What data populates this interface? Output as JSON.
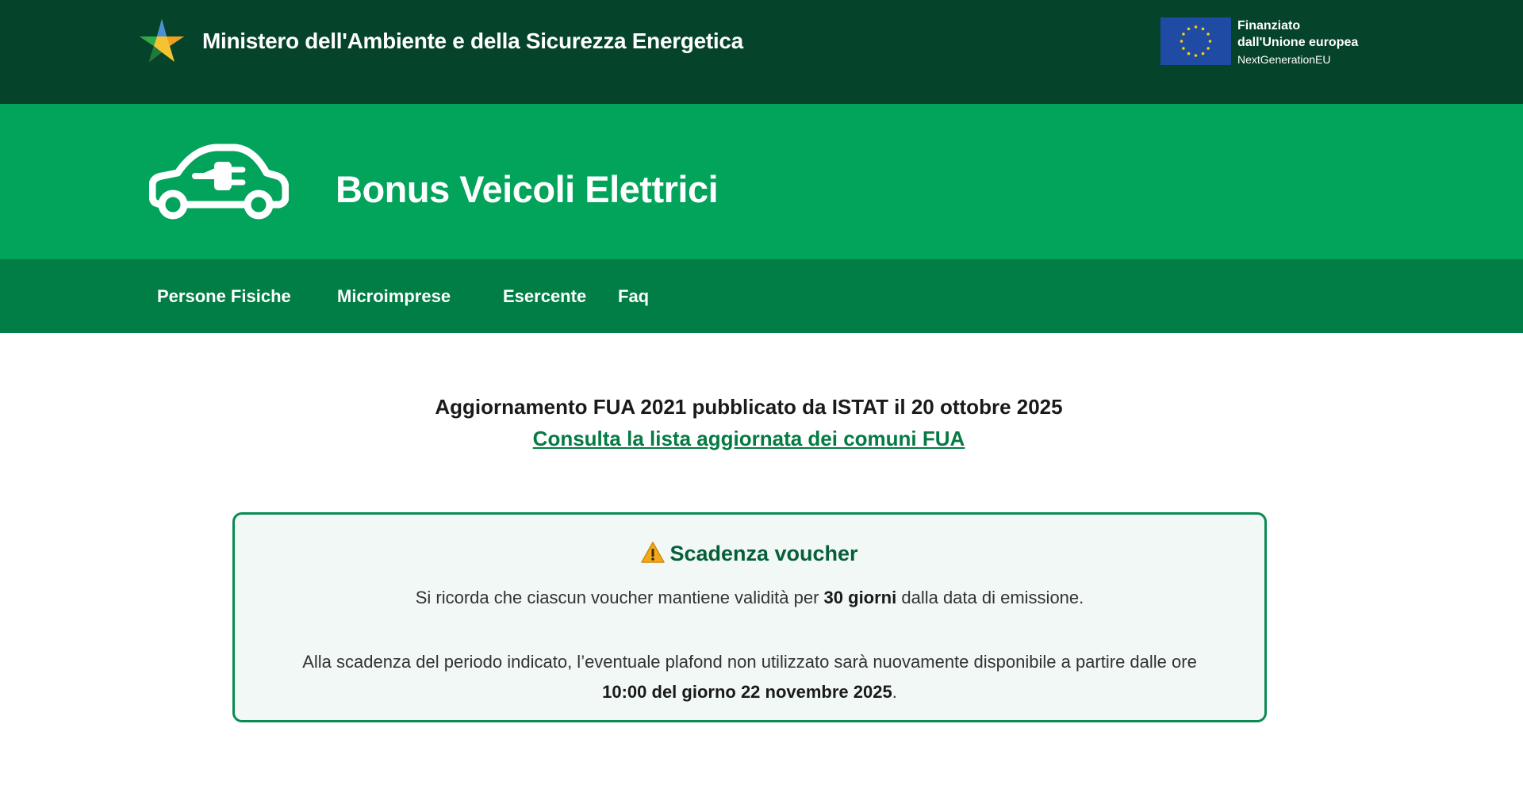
{
  "header": {
    "ministry_name": "Ministero dell'Ambiente e della Sicurezza Energetica",
    "eu_line1": "Finanziato",
    "eu_line2": "dall'Unione europea",
    "eu_line3": "NextGenerationEU"
  },
  "hero": {
    "title": "Bonus Veicoli Elettrici"
  },
  "nav": {
    "items": [
      {
        "label": "Persone Fisiche"
      },
      {
        "label": "Microimprese"
      },
      {
        "label": "Esercente"
      },
      {
        "label": "Faq"
      }
    ]
  },
  "main": {
    "update_title": "Aggiornamento FUA 2021 pubblicato da ISTAT il 20 ottobre 2025",
    "update_link": "Consulta la lista aggiornata dei comuni FUA"
  },
  "notice": {
    "title": "Scadenza voucher",
    "p1_before": "Si ricorda che ciascun voucher mantiene validità per ",
    "p1_bold": "30 giorni",
    "p1_after": " dalla data di emissione.",
    "p2_line1": "Alla scadenza del periodo indicato, l’eventuale plafond non utilizzato sarà nuovamente disponibile a partire dalle ore",
    "p2_bold": "10:00 del giorno 22 novembre 2025",
    "p2_after": "."
  },
  "colors": {
    "topbar": "#06432b",
    "hero": "#02a35a",
    "navbar": "#017e45",
    "accent_text": "#057a43",
    "notice_border": "#0a8a52",
    "notice_bg": "#f2f8f5"
  },
  "icons": {
    "ministry_logo": "ministry-star-logo",
    "eu_flag": "eu-flag-icon",
    "car": "electric-car-icon",
    "warning": "warning-icon"
  }
}
